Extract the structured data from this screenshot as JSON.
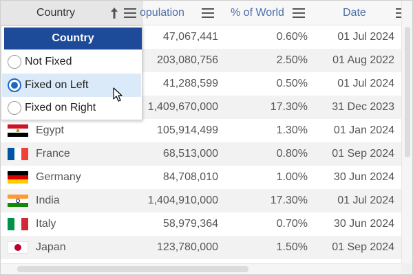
{
  "header": {
    "country": "Country",
    "population": "Population",
    "population_visible": "opulation",
    "percent_world": "% of World",
    "date": "Date"
  },
  "pin_menu": {
    "title": "Country",
    "options": [
      {
        "label": "Not Fixed",
        "selected": false
      },
      {
        "label": "Fixed on Left",
        "selected": true
      },
      {
        "label": "Fixed on Right",
        "selected": false
      }
    ]
  },
  "rows": [
    {
      "country": "",
      "population": "47,067,441",
      "percent": "0.60%",
      "date": "01 Jul 2024"
    },
    {
      "country": "",
      "population": "203,080,756",
      "percent": "2.50%",
      "date": "01 Aug 2022"
    },
    {
      "country": "",
      "population": "41,288,599",
      "percent": "0.50%",
      "date": "01 Jul 2024"
    },
    {
      "country": "",
      "population": "1,409,670,000",
      "percent": "17.30%",
      "date": "31 Dec 2023"
    },
    {
      "country": "Egypt",
      "flag": "egypt-flag",
      "population": "105,914,499",
      "percent": "1.30%",
      "date": "01 Jan 2024"
    },
    {
      "country": "France",
      "flag": "france-flag",
      "population": "68,513,000",
      "percent": "0.80%",
      "date": "01 Sep 2024"
    },
    {
      "country": "Germany",
      "flag": "germany-flag",
      "population": "84,708,010",
      "percent": "1.00%",
      "date": "30 Jun 2024"
    },
    {
      "country": "India",
      "flag": "india-flag",
      "population": "1,404,910,000",
      "percent": "17.30%",
      "date": "01 Jul 2024"
    },
    {
      "country": "Italy",
      "flag": "italy-flag",
      "population": "58,979,364",
      "percent": "0.70%",
      "date": "30 Jun 2024"
    },
    {
      "country": "Japan",
      "flag": "japan-flag",
      "population": "123,780,000",
      "percent": "1.50%",
      "date": "01 Sep 2024"
    }
  ],
  "colors": {
    "header_text": "#4a6ea9",
    "menu_title_bg": "#1e4a9a",
    "selected_option_bg": "#dbeaf8",
    "radio_accent": "#1e67c0"
  },
  "icons": {
    "column_menu": "hamburger-icon",
    "pin": "arrow-up-icon",
    "cursor": "mouse-pointer-icon"
  }
}
